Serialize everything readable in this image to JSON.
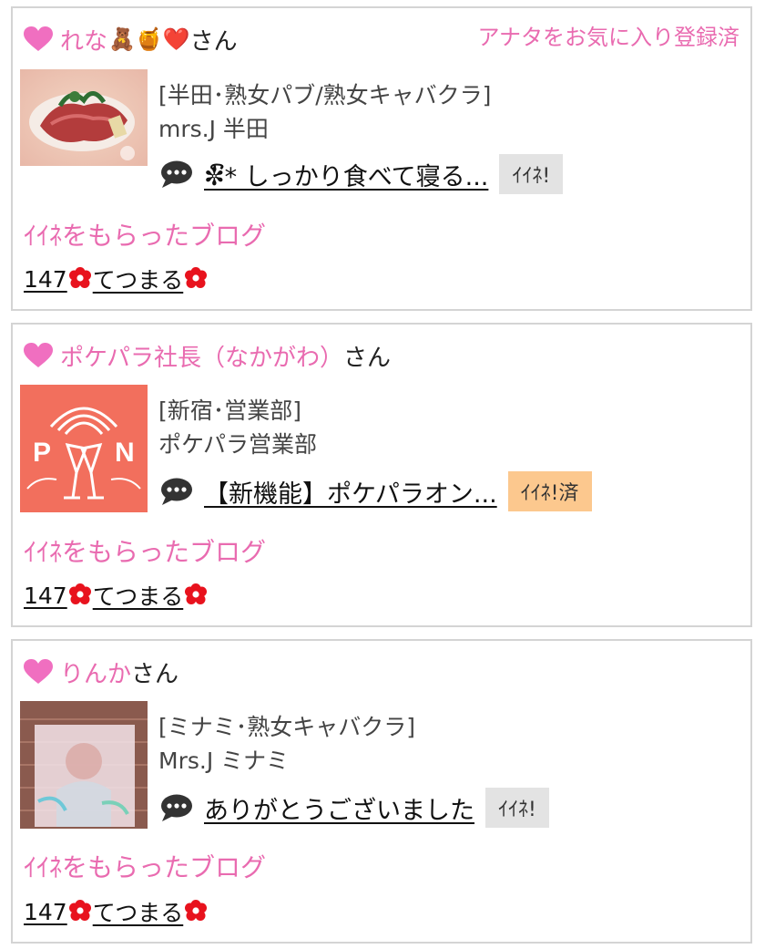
{
  "colors": {
    "accent_pink": "#e96bb0",
    "iine_done_bg": "#fcc88e",
    "iine_bg": "#e3e3e3",
    "border": "#d4d4d4"
  },
  "cards": [
    {
      "user_name": "れな",
      "name_emojis": "🧸🍯❤️",
      "honorific": "さん",
      "favorite_status": "アナタをお気に入り登録済",
      "shop_category": "[半田･熟女パブ/熟女キャバクラ]",
      "shop_name": "mrs.J 半田",
      "blog_title": "✼ົ* しっかり食べて寝る...",
      "iine_label": "ｲｲﾈ!",
      "received_title": "ｲｲﾈをもらったブログ",
      "received_count": "147",
      "received_blog": "てつまる"
    },
    {
      "user_name": "ポケパラ社長（なかがわ）",
      "honorific": "さん",
      "shop_category": "[新宿･営業部]",
      "shop_name": "ポケパラ営業部",
      "thumb_text_left": "P",
      "thumb_text_right": "N",
      "blog_title": "【新機能】ポケパラオン...",
      "iine_label": "ｲｲﾈ!済",
      "received_title": "ｲｲﾈをもらったブログ",
      "received_count": "147",
      "received_blog": "てつまる"
    },
    {
      "user_name": "りんか",
      "honorific": "さん",
      "shop_category": "[ミナミ･熟女キャバクラ]",
      "shop_name": "Mrs.J ミナミ",
      "blog_title": "ありがとうございました",
      "iine_label": "ｲｲﾈ!",
      "received_title": "ｲｲﾈをもらったブログ",
      "received_count": "147",
      "received_blog": "てつまる"
    }
  ]
}
